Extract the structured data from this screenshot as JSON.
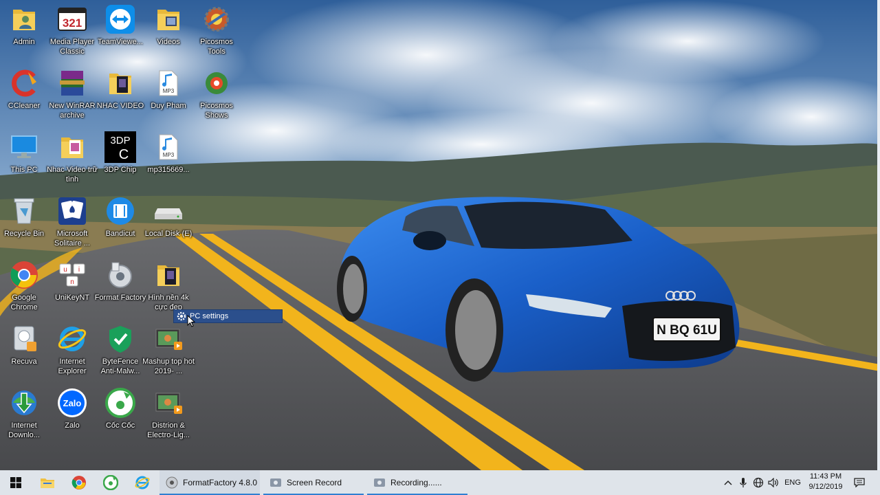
{
  "desktop": {
    "icons": [
      {
        "label": "Admin"
      },
      {
        "label": "Media Player Classic"
      },
      {
        "label": "TeamViewe..."
      },
      {
        "label": "Videos"
      },
      {
        "label": "Picosmos Tools"
      },
      {
        "label": "CCleaner"
      },
      {
        "label": "New WinRAR archive"
      },
      {
        "label": "NHAC VIDEO"
      },
      {
        "label": "Duy Pham"
      },
      {
        "label": "Picosmos Shows"
      },
      {
        "label": "This PC"
      },
      {
        "label": "Nhac Video trữ tình"
      },
      {
        "label": "3DP Chip"
      },
      {
        "label": "mp315669..."
      },
      {
        "label": "Recycle Bin"
      },
      {
        "label": "Microsoft Solitaire ..."
      },
      {
        "label": "Bandicut"
      },
      {
        "label": "Local Disk (E)"
      },
      {
        "label": "Google Chrome"
      },
      {
        "label": "UniKeyNT"
      },
      {
        "label": "Format Factory"
      },
      {
        "label": "Hình nền 4k cực đẹp"
      },
      {
        "label": "Recuva"
      },
      {
        "label": "Internet Explorer"
      },
      {
        "label": "ByteFence Anti-Malw..."
      },
      {
        "label": "Mashup top hot 2019- ..."
      },
      {
        "label": "Internet Downlo..."
      },
      {
        "label": "Zalo"
      },
      {
        "label": "Cốc Cốc"
      },
      {
        "label": "Distrion & Electro-Lig..."
      }
    ],
    "context_menu": {
      "item": "PC settings"
    },
    "wallpaper": {
      "plate": "N BQ 61U",
      "brand_color": "#1a5fc8"
    }
  },
  "taskbar": {
    "tasks": [
      {
        "label": "FormatFactory 4.8.0"
      },
      {
        "label": "Screen Record"
      },
      {
        "label": "Recording......"
      }
    ],
    "tray": {
      "language": "ENG"
    },
    "clock": {
      "time": "11:43 PM",
      "date": "9/12/2019"
    },
    "accent": "#2f7fd1"
  }
}
